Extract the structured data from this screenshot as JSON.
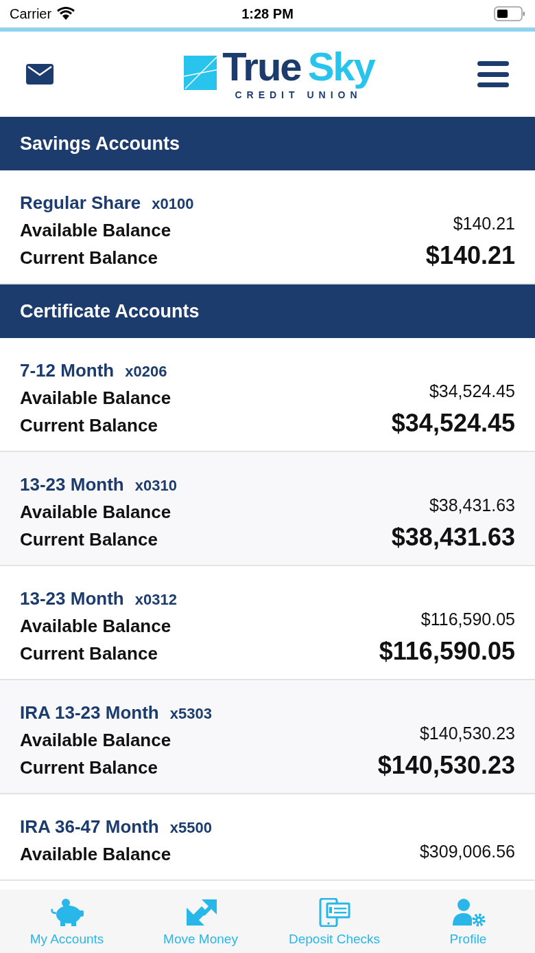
{
  "status_bar": {
    "carrier": "Carrier",
    "time": "1:28 PM"
  },
  "header": {
    "logo_main": "True",
    "logo_accent": "Sky",
    "logo_sub": "CREDIT UNION"
  },
  "sections": [
    {
      "title": "Savings Accounts",
      "accounts": [
        {
          "name": "Regular Share",
          "number": "x0100",
          "available_label": "Available Balance",
          "available": "$140.21",
          "current_label": "Current Balance",
          "current": "$140.21"
        }
      ]
    },
    {
      "title": "Certificate Accounts",
      "accounts": [
        {
          "name": "7-12 Month",
          "number": "x0206",
          "available_label": "Available Balance",
          "available": "$34,524.45",
          "current_label": "Current Balance",
          "current": "$34,524.45"
        },
        {
          "name": "13-23 Month",
          "number": "x0310",
          "available_label": "Available Balance",
          "available": "$38,431.63",
          "current_label": "Current Balance",
          "current": "$38,431.63"
        },
        {
          "name": "13-23 Month",
          "number": "x0312",
          "available_label": "Available Balance",
          "available": "$116,590.05",
          "current_label": "Current Balance",
          "current": "$116,590.05"
        },
        {
          "name": "IRA 13-23 Month",
          "number": "x5303",
          "available_label": "Available Balance",
          "available": "$140,530.23",
          "current_label": "Current Balance",
          "current": "$140,530.23"
        },
        {
          "name": "IRA 36-47 Month",
          "number": "x5500",
          "available_label": "Available Balance",
          "available": "$309,006.56"
        }
      ]
    }
  ],
  "tab_bar": [
    {
      "kind": "piggy",
      "label": "My Accounts"
    },
    {
      "kind": "transfer",
      "label": "Move Money"
    },
    {
      "kind": "check",
      "label": "Deposit Checks"
    },
    {
      "kind": "profile",
      "label": "Profile"
    }
  ]
}
